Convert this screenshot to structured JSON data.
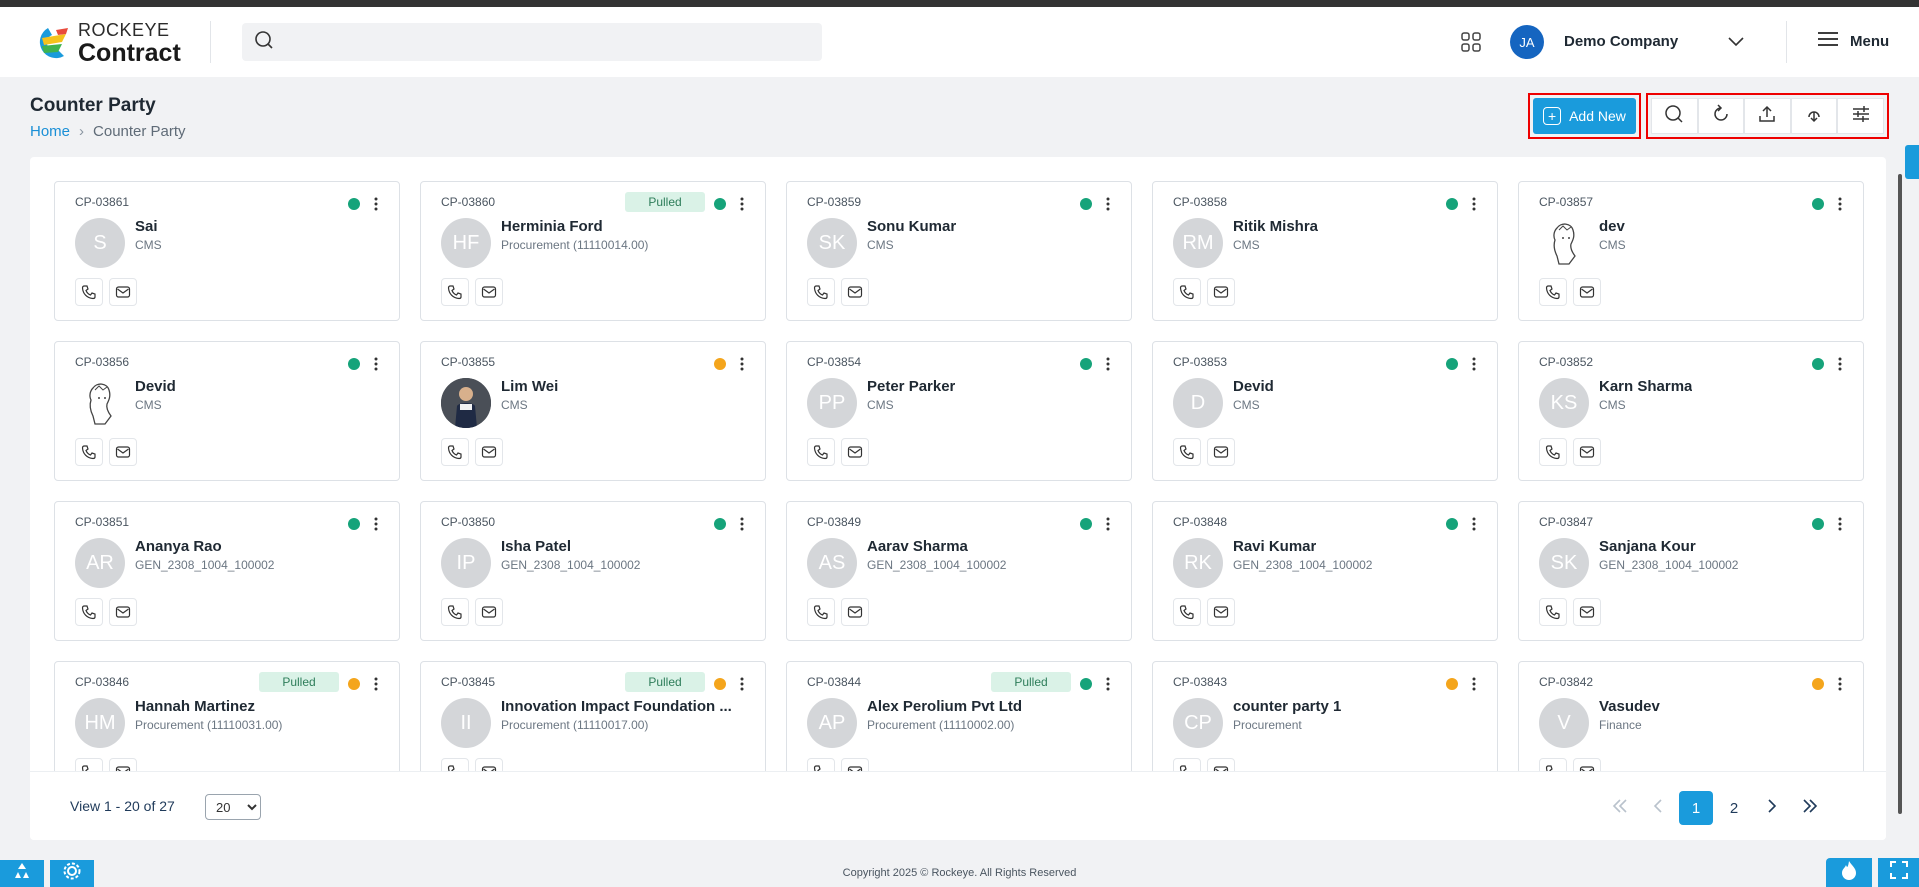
{
  "header": {
    "logo_line1": "ROCKEYE",
    "logo_line2": "Contract",
    "search_placeholder": "",
    "avatar_initials": "JA",
    "company": "Demo Company",
    "menu_label": "Menu"
  },
  "page": {
    "title": "Counter Party",
    "breadcrumb_home": "Home",
    "breadcrumb_sep": "›",
    "breadcrumb_current": "Counter Party",
    "add_new_label": "Add New"
  },
  "colors": {
    "accent": "#1a9bdc",
    "status_green": "#16a37a",
    "status_orange": "#f4a51c",
    "avatar_bg": "#1565c0",
    "highlight_border": "#ee0000"
  },
  "cards": [
    {
      "code": "CP-03861",
      "name": "Sai",
      "sub": "CMS",
      "initials": "S",
      "status": "green",
      "pulled": false,
      "avatar": "initials"
    },
    {
      "code": "CP-03860",
      "name": "Herminia Ford",
      "sub": "Procurement (11110014.00)",
      "initials": "HF",
      "status": "green",
      "pulled": true,
      "avatar": "initials"
    },
    {
      "code": "CP-03859",
      "name": "Sonu Kumar",
      "sub": "CMS",
      "initials": "SK",
      "status": "green",
      "pulled": false,
      "avatar": "initials"
    },
    {
      "code": "CP-03858",
      "name": "Ritik Mishra",
      "sub": "CMS",
      "initials": "RM",
      "status": "green",
      "pulled": false,
      "avatar": "initials"
    },
    {
      "code": "CP-03857",
      "name": "dev",
      "sub": "CMS",
      "initials": "",
      "status": "green",
      "pulled": false,
      "avatar": "sketch"
    },
    {
      "code": "CP-03856",
      "name": "Devid",
      "sub": "CMS",
      "initials": "",
      "status": "green",
      "pulled": false,
      "avatar": "sketch"
    },
    {
      "code": "CP-03855",
      "name": "Lim Wei",
      "sub": "CMS",
      "initials": "",
      "status": "orange",
      "pulled": false,
      "avatar": "photo"
    },
    {
      "code": "CP-03854",
      "name": "Peter Parker",
      "sub": "CMS",
      "initials": "PP",
      "status": "green",
      "pulled": false,
      "avatar": "initials"
    },
    {
      "code": "CP-03853",
      "name": "Devid",
      "sub": "CMS",
      "initials": "D",
      "status": "green",
      "pulled": false,
      "avatar": "initials"
    },
    {
      "code": "CP-03852",
      "name": "Karn Sharma",
      "sub": "CMS",
      "initials": "KS",
      "status": "green",
      "pulled": false,
      "avatar": "initials"
    },
    {
      "code": "CP-03851",
      "name": "Ananya Rao",
      "sub": "GEN_2308_1004_100002",
      "initials": "AR",
      "status": "green",
      "pulled": false,
      "avatar": "initials"
    },
    {
      "code": "CP-03850",
      "name": "Isha Patel",
      "sub": "GEN_2308_1004_100002",
      "initials": "IP",
      "status": "green",
      "pulled": false,
      "avatar": "initials"
    },
    {
      "code": "CP-03849",
      "name": "Aarav Sharma",
      "sub": "GEN_2308_1004_100002",
      "initials": "AS",
      "status": "green",
      "pulled": false,
      "avatar": "initials"
    },
    {
      "code": "CP-03848",
      "name": "Ravi Kumar",
      "sub": "GEN_2308_1004_100002",
      "initials": "RK",
      "status": "green",
      "pulled": false,
      "avatar": "initials"
    },
    {
      "code": "CP-03847",
      "name": "Sanjana Kour",
      "sub": "GEN_2308_1004_100002",
      "initials": "SK",
      "status": "green",
      "pulled": false,
      "avatar": "initials"
    },
    {
      "code": "CP-03846",
      "name": "Hannah Martinez",
      "sub": "Procurement (11110031.00)",
      "initials": "HM",
      "status": "orange",
      "pulled": true,
      "avatar": "initials"
    },
    {
      "code": "CP-03845",
      "name": "Innovation Impact Foundation ...",
      "sub": "Procurement (11110017.00)",
      "initials": "II",
      "status": "orange",
      "pulled": true,
      "avatar": "initials"
    },
    {
      "code": "CP-03844",
      "name": "Alex Perolium Pvt Ltd",
      "sub": "Procurement (11110002.00)",
      "initials": "AP",
      "status": "green",
      "pulled": true,
      "avatar": "initials"
    },
    {
      "code": "CP-03843",
      "name": "counter party 1",
      "sub": "Procurement",
      "initials": "CP",
      "status": "orange",
      "pulled": false,
      "avatar": "initials"
    },
    {
      "code": "CP-03842",
      "name": "Vasudev",
      "sub": "Finance",
      "initials": "V",
      "status": "orange",
      "pulled": false,
      "avatar": "initials"
    }
  ],
  "pulled_label": "Pulled",
  "footer": {
    "view_text": "View 1 - 20 of 27",
    "per_page_selected": "20",
    "pages": [
      "1",
      "2"
    ],
    "active_page": "1",
    "copyright": "Copyright 2025 © Rockeye. All Rights Reserved"
  },
  "icons": {
    "search": "search-icon",
    "apps": "grid-apps-icon",
    "chevron": "chevron-down-icon",
    "menu": "hamburger-icon",
    "toolbar": [
      "search-icon",
      "refresh-icon",
      "upload-icon",
      "cloud-download-icon",
      "filter-sliders-icon"
    ],
    "card_actions": [
      "phone-icon",
      "mail-icon"
    ]
  }
}
